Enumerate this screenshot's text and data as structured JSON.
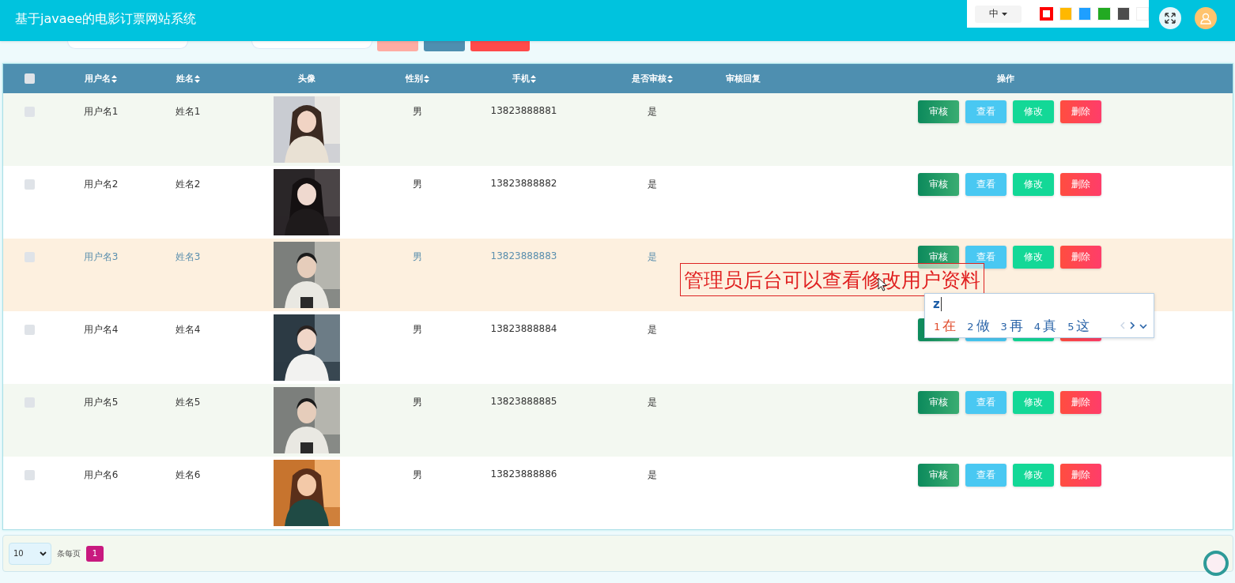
{
  "header": {
    "title": "基于javaee的电影订票网站系统",
    "language": "中",
    "theme_colors": [
      {
        "color": "#ff0000",
        "selected": true
      },
      {
        "color": "#ffb800",
        "selected": false
      },
      {
        "color": "#1e9fff",
        "selected": false
      },
      {
        "color": "#22aa22",
        "selected": false
      },
      {
        "color": "#4d4d4d",
        "selected": false
      },
      {
        "color": "#ffffff",
        "selected": false
      }
    ]
  },
  "toolbar": {
    "fields": [
      {
        "kind": "field"
      },
      {
        "kind": "field"
      }
    ],
    "buttons": [
      {
        "color": "#ffaca3"
      },
      {
        "color": "#4e8fb0"
      },
      {
        "color": "#ff4a4a"
      }
    ]
  },
  "table": {
    "select_all": {
      "checked": false
    },
    "columns": [
      {
        "label": "用户名",
        "sortable": true
      },
      {
        "label": "姓名",
        "sortable": true
      },
      {
        "label": "头像",
        "sortable": false
      },
      {
        "label": "性别",
        "sortable": true
      },
      {
        "label": "手机",
        "sortable": true
      },
      {
        "label": "是否审核",
        "sortable": true
      },
      {
        "label": "审核回复",
        "sortable": false
      },
      {
        "label": "操作",
        "sortable": false
      }
    ],
    "rows": [
      {
        "checked": false,
        "highlighted": false,
        "username": "用户名1",
        "name": "姓名1",
        "avatar": {
          "kind": "picture"
        },
        "gender": "男",
        "phone": "13823888881",
        "approved": "是",
        "actions": [
          {
            "kind": "review",
            "label": "审核"
          },
          {
            "kind": "view",
            "label": "查看"
          },
          {
            "kind": "edit",
            "label": "修改"
          },
          {
            "kind": "delete",
            "label": "删除"
          }
        ]
      },
      {
        "checked": false,
        "highlighted": false,
        "username": "用户名2",
        "name": "姓名2",
        "avatar": {
          "kind": "picture"
        },
        "gender": "男",
        "phone": "13823888882",
        "approved": "是",
        "actions": [
          {
            "kind": "review",
            "label": "审核"
          },
          {
            "kind": "view",
            "label": "查看"
          },
          {
            "kind": "edit",
            "label": "修改"
          },
          {
            "kind": "delete",
            "label": "删除"
          }
        ]
      },
      {
        "checked": false,
        "highlighted": true,
        "username": "用户名3",
        "name": "姓名3",
        "avatar": {
          "kind": "picture"
        },
        "gender": "男",
        "phone": "13823888883",
        "approved": "是",
        "actions": [
          {
            "kind": "review",
            "label": "审核"
          },
          {
            "kind": "view",
            "label": "查看"
          },
          {
            "kind": "edit",
            "label": "修改"
          },
          {
            "kind": "delete",
            "label": "删除"
          }
        ]
      },
      {
        "checked": false,
        "highlighted": false,
        "username": "用户名4",
        "name": "姓名4",
        "avatar": {
          "kind": "picture"
        },
        "gender": "男",
        "phone": "13823888884",
        "approved": "是",
        "actions": [
          {
            "kind": "review"
          },
          {
            "kind": "view"
          },
          {
            "kind": "edit"
          },
          {
            "kind": "delete"
          }
        ]
      },
      {
        "checked": false,
        "highlighted": false,
        "username": "用户名5",
        "name": "姓名5",
        "avatar": {
          "kind": "picture"
        },
        "gender": "男",
        "phone": "13823888885",
        "approved": "是",
        "actions": [
          {
            "kind": "review",
            "label": "审核"
          },
          {
            "kind": "view",
            "label": "查看"
          },
          {
            "kind": "edit",
            "label": "修改"
          },
          {
            "kind": "delete",
            "label": "删除"
          }
        ]
      },
      {
        "checked": false,
        "highlighted": false,
        "username": "用户名6",
        "name": "姓名6",
        "avatar": {
          "kind": "picture"
        },
        "gender": "男",
        "phone": "13823888886",
        "approved": "是",
        "actions": [
          {
            "kind": "review",
            "label": "审核"
          },
          {
            "kind": "view",
            "label": "查看"
          },
          {
            "kind": "edit",
            "label": "修改"
          },
          {
            "kind": "delete",
            "label": "删除"
          }
        ]
      }
    ]
  },
  "pagination": {
    "page_size": "10",
    "page_size_label": "条每页",
    "pages": [
      {
        "label": "1",
        "selected": true
      }
    ]
  },
  "annotation": {
    "text": "管理员后台可以查看修改用户资料"
  },
  "ime": {
    "input": "z",
    "candidates": [
      {
        "number": "1",
        "text": "在",
        "selected": true
      },
      {
        "number": "2",
        "text": "做",
        "selected": false
      },
      {
        "number": "3",
        "text": "再",
        "selected": false
      },
      {
        "number": "4",
        "text": "真",
        "selected": false
      },
      {
        "number": "5",
        "text": "这",
        "selected": false
      }
    ]
  }
}
